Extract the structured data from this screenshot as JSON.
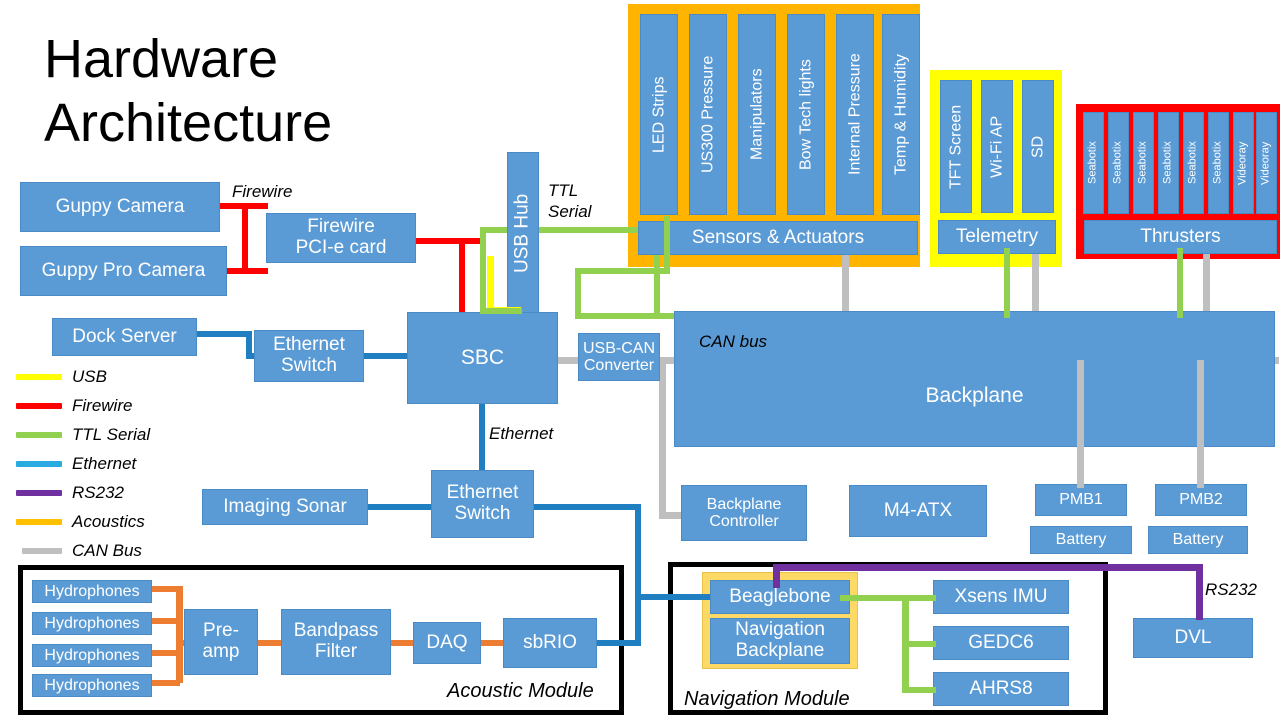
{
  "title": {
    "line1": "Hardware",
    "line2": "Architecture"
  },
  "colors": {
    "node": "#5B9BD5",
    "usb": "#FFFF00",
    "firewire": "#FF0000",
    "ttl_serial": "#92D050",
    "ethernet": "#1F7FC0",
    "rs232": "#7030A0",
    "acoustics": "#ED7D31",
    "can_bus": "#BFBFBF",
    "sensors_group": "#FFB400",
    "telemetry_group": "#FFFF00",
    "thrusters_group": "#FF0000",
    "nav_backplane_group": "#FFD966",
    "module_frame": "#000000"
  },
  "legend": {
    "items": [
      {
        "label": "USB",
        "color": "#FFFF00"
      },
      {
        "label": "Firewire",
        "color": "#FF0000"
      },
      {
        "label": "TTL Serial",
        "color": "#92D050"
      },
      {
        "label": "Ethernet",
        "color": "#29ABE2"
      },
      {
        "label": "RS232",
        "color": "#7030A0"
      },
      {
        "label": "Acoustics",
        "color": "#FFC000"
      },
      {
        "label": "CAN Bus",
        "color": "#BFBFBF"
      }
    ]
  },
  "nodes": {
    "guppy_camera": "Guppy Camera",
    "guppy_pro_camera": "Guppy Pro Camera",
    "firewire_card": "Firewire\nPCI-e card",
    "firewire_card_l1": "Firewire",
    "firewire_card_l2": "PCI-e card",
    "dock_server": "Dock Server",
    "ethernet_switch_top_l1": "Ethernet",
    "ethernet_switch_top_l2": "Switch",
    "sbc": "SBC",
    "usb_hub": "USB Hub",
    "usb_can_converter_l1": "USB-CAN",
    "usb_can_converter_l2": "Converter",
    "imaging_sonar": "Imaging Sonar",
    "ethernet_switch_bottom_l1": "Ethernet",
    "ethernet_switch_bottom_l2": "Switch",
    "backplane": "Backplane",
    "backplane_controller_l1": "Backplane",
    "backplane_controller_l2": "Controller",
    "m4_atx": "M4-ATX",
    "pmb1": "PMB1",
    "pmb2": "PMB2",
    "battery1": "Battery",
    "battery2": "Battery",
    "dvl": "DVL"
  },
  "sensors_group": {
    "title": "Sensors & Actuators",
    "items": [
      "LED Strips",
      "US300 Pressure",
      "Manipulators",
      "Bow Tech lights",
      "Internal Pressure",
      "Temp & Humidity"
    ]
  },
  "telemetry_group": {
    "title": "Telemetry",
    "items": [
      "TFT Screen",
      "Wi-Fi AP",
      "SD"
    ]
  },
  "thrusters_group": {
    "title": "Thrusters",
    "items": [
      "Seabotix",
      "Seabotix",
      "Seabotix",
      "Seabotix",
      "Seabotix",
      "Seabotix",
      "Videoray",
      "Videoray"
    ]
  },
  "acoustic_module": {
    "title": "Acoustic Module",
    "hydrophones": [
      "Hydrophones",
      "Hydrophones",
      "Hydrophones",
      "Hydrophones"
    ],
    "chain": [
      "Pre-amp",
      "Bandpass Filter",
      "DAQ",
      "sbRIO"
    ],
    "preamp_l1": "Pre-",
    "preamp_l2": "amp",
    "bandpass_l1": "Bandpass",
    "bandpass_l2": "Filter",
    "daq": "DAQ",
    "sbrio": "sbRIO"
  },
  "navigation_module": {
    "title": "Navigation Module",
    "beaglebone": "Beaglebone",
    "nav_backplane_l1": "Navigation",
    "nav_backplane_l2": "Backplane",
    "sensors": [
      "Xsens IMU",
      "GEDC6",
      "AHRS8"
    ]
  },
  "link_labels": {
    "firewire": "Firewire",
    "ttl_serial_l1": "TTL",
    "ttl_serial_l2": "Serial",
    "can_bus": "CAN bus",
    "ethernet": "Ethernet",
    "rs232": "RS232"
  }
}
